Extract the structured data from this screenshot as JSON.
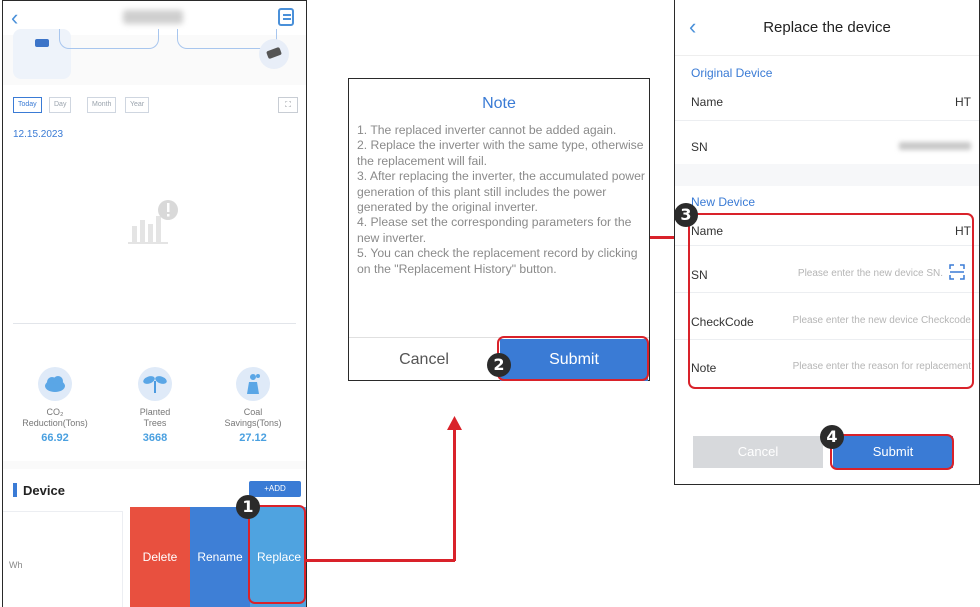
{
  "phone1": {
    "tabs": [
      "Today",
      "Day",
      "Month",
      "Year"
    ],
    "expand_symbol": "⛶",
    "date": "12.15.2023",
    "stats": [
      {
        "label_line1": "CO₂",
        "label_line2": "Reduction(Tons)",
        "value": "66.92"
      },
      {
        "label_line1": "Planted",
        "label_line2": "Trees",
        "value": "3668"
      },
      {
        "label_line1": "Coal",
        "label_line2": "Savings(Tons)",
        "value": "27.12"
      }
    ],
    "device_title": "Device",
    "add_label": "+ADD",
    "card_text": "Wh",
    "actions": {
      "delete": "Delete",
      "rename": "Rename",
      "replace": "Replace"
    }
  },
  "dialog": {
    "title": "Note",
    "text": "1. The replaced inverter cannot be added again.\n2. Replace the inverter with the same type, otherwise the replacement will fail.\n3. After replacing the inverter, the accumulated power generation of this plant still includes the power generated by the original inverter.\n4. Please set the corresponding parameters for the new inverter.\n5. You can check the replacement record by clicking on the \"Replacement History\" button.",
    "cancel": "Cancel",
    "submit": "Submit"
  },
  "phone3": {
    "title": "Replace the device",
    "original_section": "Original Device",
    "original": {
      "name_label": "Name",
      "name_value": "HT",
      "sn_label": "SN"
    },
    "new_section": "New Device",
    "fields": {
      "name_label": "Name",
      "name_value": "HT",
      "sn_label": "SN",
      "sn_placeholder": "Please enter the new device SN.",
      "checkcode_label": "CheckCode",
      "checkcode_placeholder": "Please enter the new device Checkcode",
      "note_label": "Note",
      "note_placeholder": "Please enter the reason for replacement"
    },
    "cancel": "Cancel",
    "submit": "Submit"
  },
  "badges": [
    "1",
    "2",
    "3",
    "4"
  ],
  "colors": {
    "accent": "#3a7bd5",
    "highlight": "#d9222a",
    "delete": "#e8503f",
    "rename": "#3e7fd6",
    "replace": "#4fa3e0"
  }
}
